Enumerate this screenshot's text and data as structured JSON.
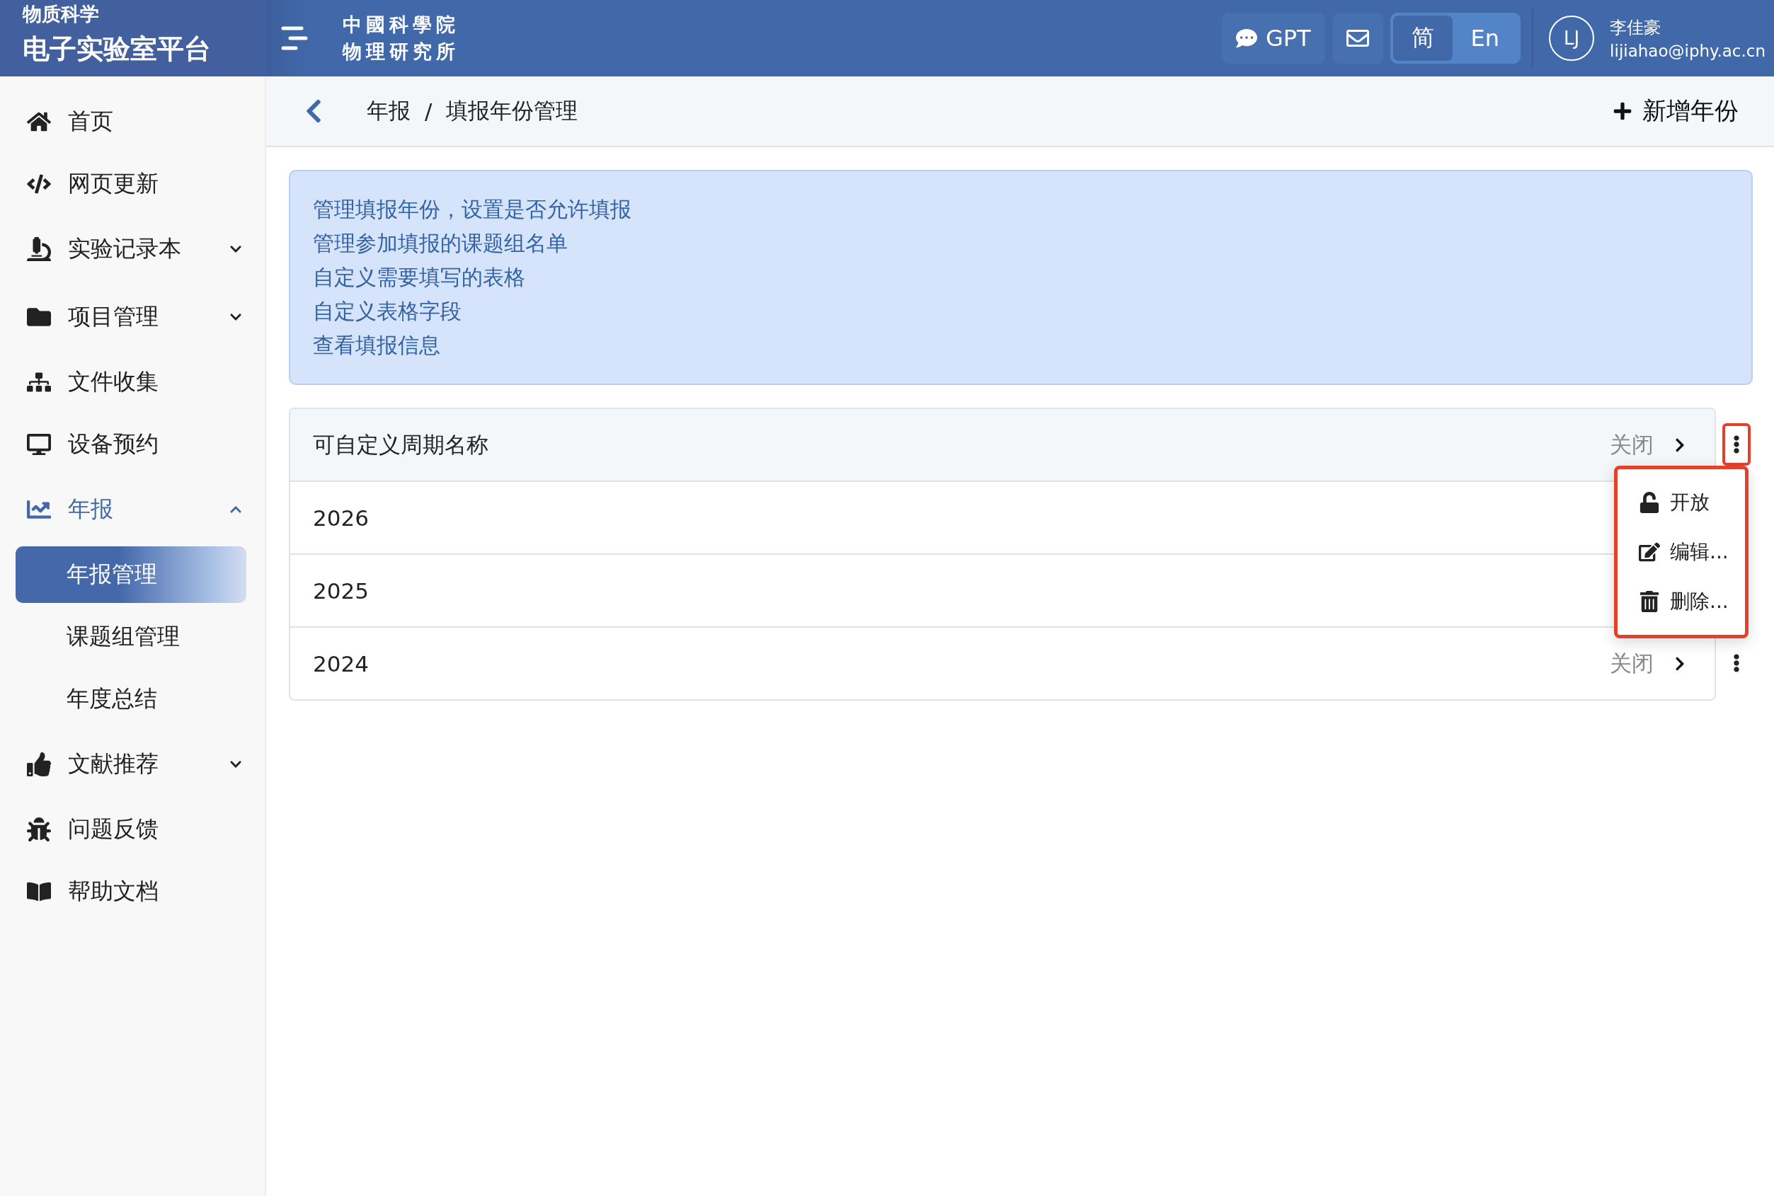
{
  "brand": {
    "subtitle": "物质科学",
    "title": "电子实验室平台"
  },
  "institute": {
    "line1": "中國科學院",
    "line2": "物理研究所"
  },
  "topbar": {
    "gpt": "GPT",
    "languages": [
      {
        "label": "简",
        "selected": true
      },
      {
        "label": "En",
        "selected": false
      }
    ],
    "user": {
      "initials": "LJ",
      "name": "李佳豪",
      "email": "lijiahao@iphy.ac.cn"
    }
  },
  "sidebar": {
    "items": [
      {
        "label": "首页",
        "selected": false
      },
      {
        "label": "网页更新",
        "selected": false
      },
      {
        "label": "实验记录本",
        "selected": false,
        "expanded": false
      },
      {
        "label": "项目管理",
        "selected": false,
        "expanded": false
      },
      {
        "label": "文件收集",
        "selected": false
      },
      {
        "label": "设备预约",
        "selected": false
      },
      {
        "label": "年报",
        "selected": true,
        "expanded": true,
        "children": [
          {
            "label": "年报管理",
            "selected": true
          },
          {
            "label": "课题组管理",
            "selected": false
          },
          {
            "label": "年度总结",
            "selected": false
          }
        ]
      },
      {
        "label": "文献推荐",
        "selected": false,
        "expanded": false
      },
      {
        "label": "问题反馈",
        "selected": false
      },
      {
        "label": "帮助文档",
        "selected": false
      }
    ]
  },
  "breadcrumb": {
    "items": [
      "年报",
      "填报年份管理"
    ],
    "separator": "/"
  },
  "add_button": "新增年份",
  "info": [
    "管理填报年份，设置是否允许填报",
    "管理参加填报的课题组名单",
    "自定义需要填写的表格",
    "自定义表格字段",
    "查看填报信息"
  ],
  "rows": [
    {
      "name": "可自定义周期名称",
      "status": "关闭",
      "menu_open": true
    },
    {
      "name": "2026"
    },
    {
      "name": "2025"
    },
    {
      "name": "2024",
      "status": "关闭",
      "menu_open": false
    }
  ],
  "menu": [
    {
      "label": "开放"
    },
    {
      "label": "编辑..."
    },
    {
      "label": "删除..."
    }
  ]
}
